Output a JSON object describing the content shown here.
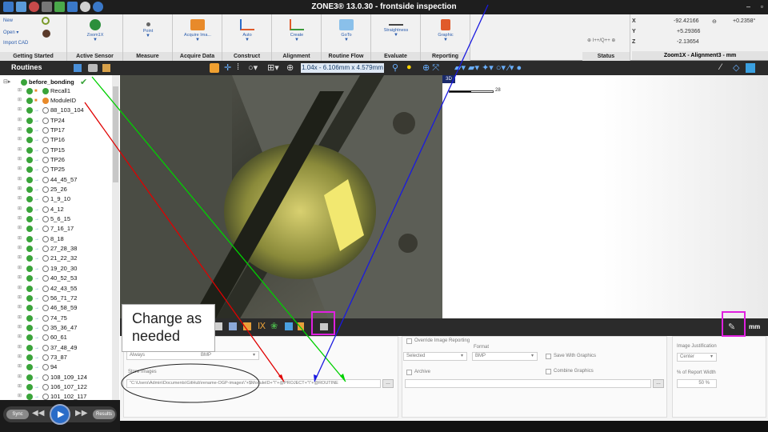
{
  "title": "ZONE3® 13.0.30 - frontside inspection",
  "ribbon": {
    "left_items": [
      "New",
      "Open",
      "Import CAD"
    ],
    "buttons": [
      {
        "label": "Zoom1X",
        "group": "Active Sensor"
      },
      {
        "label": "Point",
        "group": "Measure"
      },
      {
        "label": "Acquire Ima...",
        "group": "Acquire Data"
      },
      {
        "label": "Auto",
        "group": "Construct"
      },
      {
        "label": "Create",
        "group": "Alignment"
      },
      {
        "label": "GoTo",
        "group": "Routine Flow"
      },
      {
        "label": "Straightness",
        "group": "Evaluate"
      },
      {
        "label": "Graphic",
        "group": "Reporting"
      }
    ],
    "group_getting_started": "Getting Started",
    "status_small": "⊕ I++/Q++ ⊕",
    "status_group": "Status",
    "readout": {
      "x_label": "X",
      "x_value": "-92.42166",
      "y_label": "Y",
      "y_value": "+5.29366",
      "z_label": "Z",
      "z_value": "-2.13654",
      "angle_value": "+0.2358°",
      "group_label": "Zoom1X - Alignment3 - mm"
    }
  },
  "toolbar": {
    "routines_title": "Routines",
    "zoom_readout": "1.04x - 6.106mm x 4.579mm"
  },
  "tree": {
    "root": "before_bonding",
    "items": [
      "Recall1",
      "ModuleID",
      "88_103_104",
      "TP24",
      "TP17",
      "TP16",
      "TP15",
      "TP26",
      "TP25",
      "44_45_57",
      "25_26",
      "1_9_10",
      "4_12",
      "5_6_15",
      "7_16_17",
      "8_18",
      "27_28_38",
      "21_22_32",
      "19_20_30",
      "40_52_53",
      "42_43_55",
      "56_71_72",
      "46_58_59",
      "74_75",
      "35_36_47",
      "60_61",
      "37_48_49",
      "73_87",
      "94",
      "108_109_124",
      "106_107_122",
      "101_102_117"
    ]
  },
  "view3d": {
    "tag": "3D",
    "scale_label": "28"
  },
  "panel": {
    "unit": "mm",
    "mode_value": "Always",
    "mode_suffix": "BMP",
    "store_images_label": "Store Images",
    "store_path": "\"C:\\Users\\Admin\\Documents\\GitHub\\rename-OGP-images\\\"+$ModuleID+\"\\\"+@PROJECT+\"\\\"+@ROUTINE",
    "override_label": "Override Image Reporting",
    "format_label": "Format",
    "selected_value": "Selected",
    "format_value": "BMP",
    "save_graphics_label": "Save With Graphics",
    "combine_graphics_label": "Combine Graphics",
    "archive_label": "Archive",
    "justification_label": "Image Justification",
    "justification_value": "Center",
    "width_label": "% of Report Width",
    "width_value": "50 %"
  },
  "callout_text": "Change as needed",
  "playback": {
    "sync": "Sync",
    "results": "Results"
  },
  "colors": {
    "highlight": "#e020e0",
    "arrow_red": "#e00000",
    "arrow_green": "#00d000",
    "arrow_blue": "#1a1ae0"
  }
}
